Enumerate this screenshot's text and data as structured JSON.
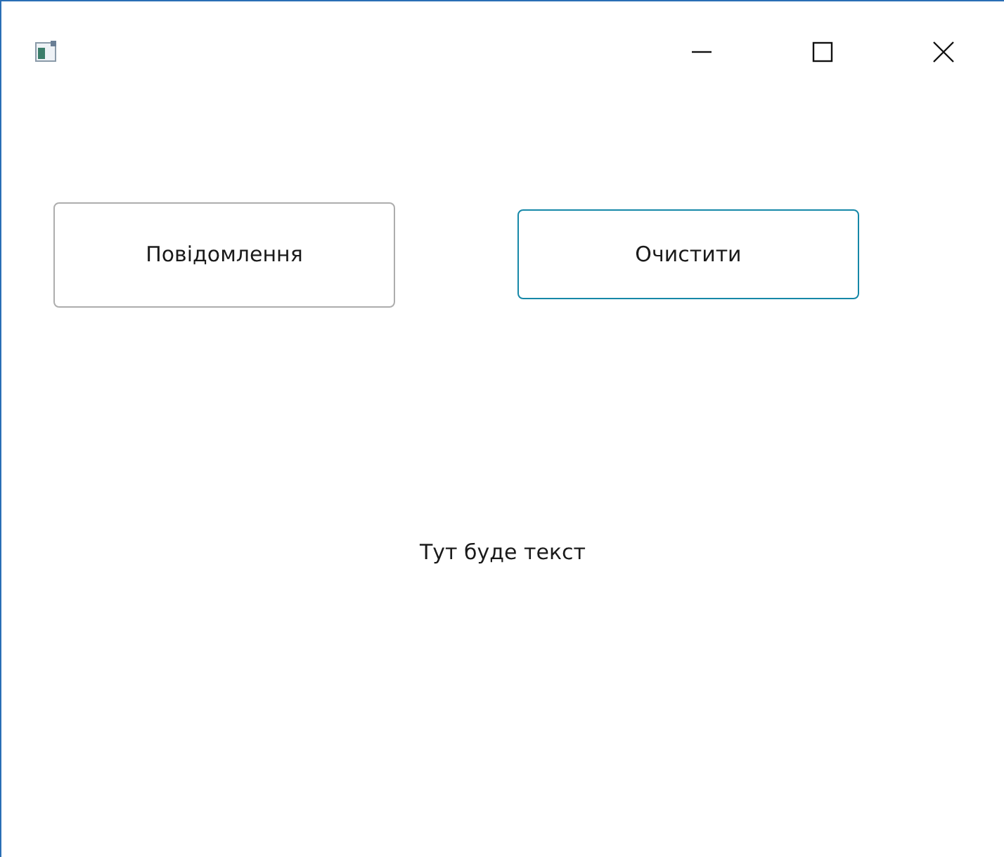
{
  "window": {
    "title_bar": {
      "controls": [
        {
          "kind": "minimize"
        },
        {
          "kind": "maximize"
        },
        {
          "kind": "close"
        }
      ]
    }
  },
  "buttons": [
    {
      "label": "Повідомлення",
      "focused": false
    },
    {
      "label": "Очистити",
      "focused": true
    }
  ],
  "output_text": "Тут буде текст"
}
